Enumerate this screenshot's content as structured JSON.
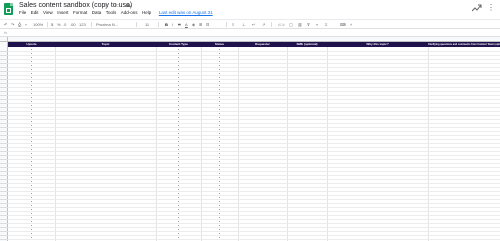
{
  "app": {
    "title": "Sales content sandbox (copy to use)",
    "title_icons": [
      "star-icon",
      "move-to-folder-icon",
      "cloud-saved-icon"
    ],
    "brand_color": "#0f9d58"
  },
  "menu": {
    "items": [
      "File",
      "Edit",
      "View",
      "Insert",
      "Format",
      "Data",
      "Tools",
      "Add-ons",
      "Help"
    ],
    "last_edit": "Last edit was on August 31"
  },
  "toolbar": {
    "zoom": "100%",
    "currency": "$",
    "percent": "%",
    "decimal_decrease": ".0",
    "decimal_increase": ".00",
    "number_format": "123",
    "font": "Proxima N...",
    "font_size": "11",
    "bold": "B",
    "italic": "I",
    "strikethrough": "S",
    "text_color": "A"
  },
  "formula_bar": {
    "fx": "fx"
  },
  "sheet": {
    "header_color": "#20124d",
    "headers": [
      "Upvote",
      "Topic",
      "Content Type",
      "Status",
      "Requester",
      "SME (optional)",
      "Why this topic?",
      "Clarifying questions and comments from Content Team (optional)"
    ],
    "dropdown_columns": [
      "Upvote",
      "Content Type",
      "Status"
    ],
    "visible_row_count": 50
  }
}
